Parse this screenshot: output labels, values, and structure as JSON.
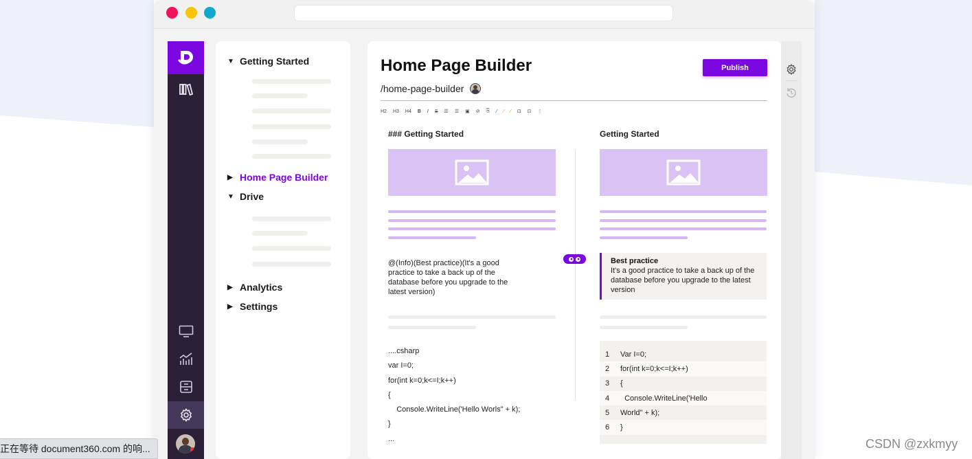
{
  "editor": {
    "title": "Home Page Builder",
    "publish_label": "Publish",
    "slug": "/home-page-builder",
    "toolbar": [
      "H2",
      "H3",
      "H4",
      "B",
      "I",
      "S",
      "☰",
      "☰",
      "▣",
      "⊘",
      "⎘",
      "⁄",
      "⁄",
      "⁄",
      "⊡",
      "⊡",
      "⋮"
    ],
    "markdown": {
      "heading": "### Getting Started",
      "info": "@(Info)(Best practice)(It's a good practice to take a back up of the database before you upgrade to the latest version)",
      "code_lines": [
        "....csharp",
        "var I=0;",
        "for(int k=0;k<=I;k++)",
        "{",
        "    Console.WriteLine('Hello Worls\" + k);",
        "}",
        "..."
      ]
    },
    "preview": {
      "heading": "Getting Started",
      "callout_title": "Best practice",
      "callout_text": "It's a good practice to take a back up of the database before you upgrade to the latest version",
      "code_rows": [
        {
          "num": "1",
          "text": "Var I=0;"
        },
        {
          "num": "2",
          "text": "for(int k=0;k<=I;k++)"
        },
        {
          "num": "3",
          "text": "{"
        },
        {
          "num": "4",
          "text": "  Console.WriteLine('Hello"
        },
        {
          "num": "5",
          "text": "World\" + k);"
        },
        {
          "num": "6",
          "text": "}"
        }
      ]
    }
  },
  "tree": {
    "getting_started": "Getting Started",
    "home_page_builder": "Home Page Builder",
    "drive": "Drive",
    "analytics": "Analytics",
    "settings": "Settings"
  },
  "leftnav_icons": [
    "logo-icon",
    "library-icon",
    "monitor-icon",
    "analytics-icon",
    "archive-icon",
    "settings-icon"
  ],
  "status": {
    "text": "正在等待 document360.com 的响..."
  },
  "watermark": {
    "text": "CSDN @zxkmyy"
  },
  "colors": {
    "accent": "#7a07e0",
    "nav_bg": "#2b2038",
    "placeholder_purple": "#dbc2f4"
  }
}
